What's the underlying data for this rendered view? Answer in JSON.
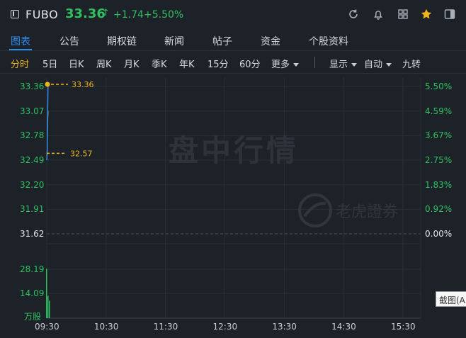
{
  "header": {
    "ticker": "FUBO",
    "price": "33.36",
    "price_arrow": "↑",
    "change": "+1.74",
    "change_pct": "+5.50%"
  },
  "tabs": [
    {
      "label": "图表",
      "active": true
    },
    {
      "label": "公告"
    },
    {
      "label": "期权链"
    },
    {
      "label": "新闻"
    },
    {
      "label": "帖子"
    },
    {
      "label": "资金"
    },
    {
      "label": "个股资料"
    }
  ],
  "toolbar": {
    "periods": [
      "分时",
      "5日",
      "日K",
      "周K",
      "月K",
      "季K",
      "年K",
      "15分",
      "60分"
    ],
    "more": "更多",
    "display": "显示",
    "auto": "自动",
    "nine": "九转"
  },
  "chart_data": {
    "type": "line",
    "y_left": [
      "33.36",
      "33.07",
      "32.78",
      "32.49",
      "32.20",
      "31.91",
      "31.62"
    ],
    "y_right": [
      "5.50%",
      "4.59%",
      "3.67%",
      "2.75%",
      "1.83%",
      "0.92%",
      "0.00%"
    ],
    "volume_ticks": [
      "28.19",
      "14.09",
      "万股"
    ],
    "x_ticks": [
      "09:30",
      "10:30",
      "11:30",
      "12:30",
      "13:30",
      "14:30",
      "15:30"
    ],
    "price_high_label": "33.36",
    "price_low_label": "32.57",
    "prev_close": 31.62,
    "ylim": [
      31.62,
      33.36
    ],
    "volume_max": 42.28,
    "price_series": [
      32.49,
      32.57,
      33.0,
      33.36
    ],
    "avg_series": [
      32.49,
      32.6,
      32.9,
      33.07
    ],
    "volume_series": [
      31.0,
      14.0,
      11.0
    ]
  },
  "watermark": {
    "main": "盘中行情",
    "brand": "老虎證券"
  },
  "screenshot_button": "截图(Al"
}
